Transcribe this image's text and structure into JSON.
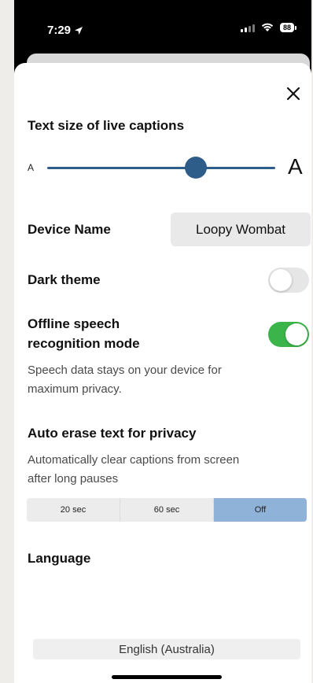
{
  "status_bar": {
    "time": "7:29",
    "battery": "88"
  },
  "close_icon": "close-icon",
  "captions": {
    "title": "Text size of live captions",
    "small_label": "A",
    "large_label": "A",
    "slider_fraction": 0.65
  },
  "device": {
    "label": "Device Name",
    "value": "Loopy Wombat"
  },
  "dark_theme": {
    "label": "Dark theme",
    "enabled": false
  },
  "offline": {
    "label_line1": "Offline speech",
    "label_line2": "recognition mode",
    "enabled": true,
    "desc_line1": "Speech data stays on your device for",
    "desc_line2": "maximum privacy."
  },
  "auto_erase": {
    "title": "Auto erase text for privacy",
    "desc_line1": "Automatically clear captions from screen",
    "desc_line2": "after long pauses",
    "options": [
      "20 sec",
      "60 sec",
      "Off"
    ],
    "selected": "Off"
  },
  "language": {
    "title": "Language",
    "value": "English (Australia)"
  },
  "colors": {
    "accent": "#2e5d8a",
    "toggle_on": "#3bb54a",
    "segment_active": "#8fb2d9"
  }
}
